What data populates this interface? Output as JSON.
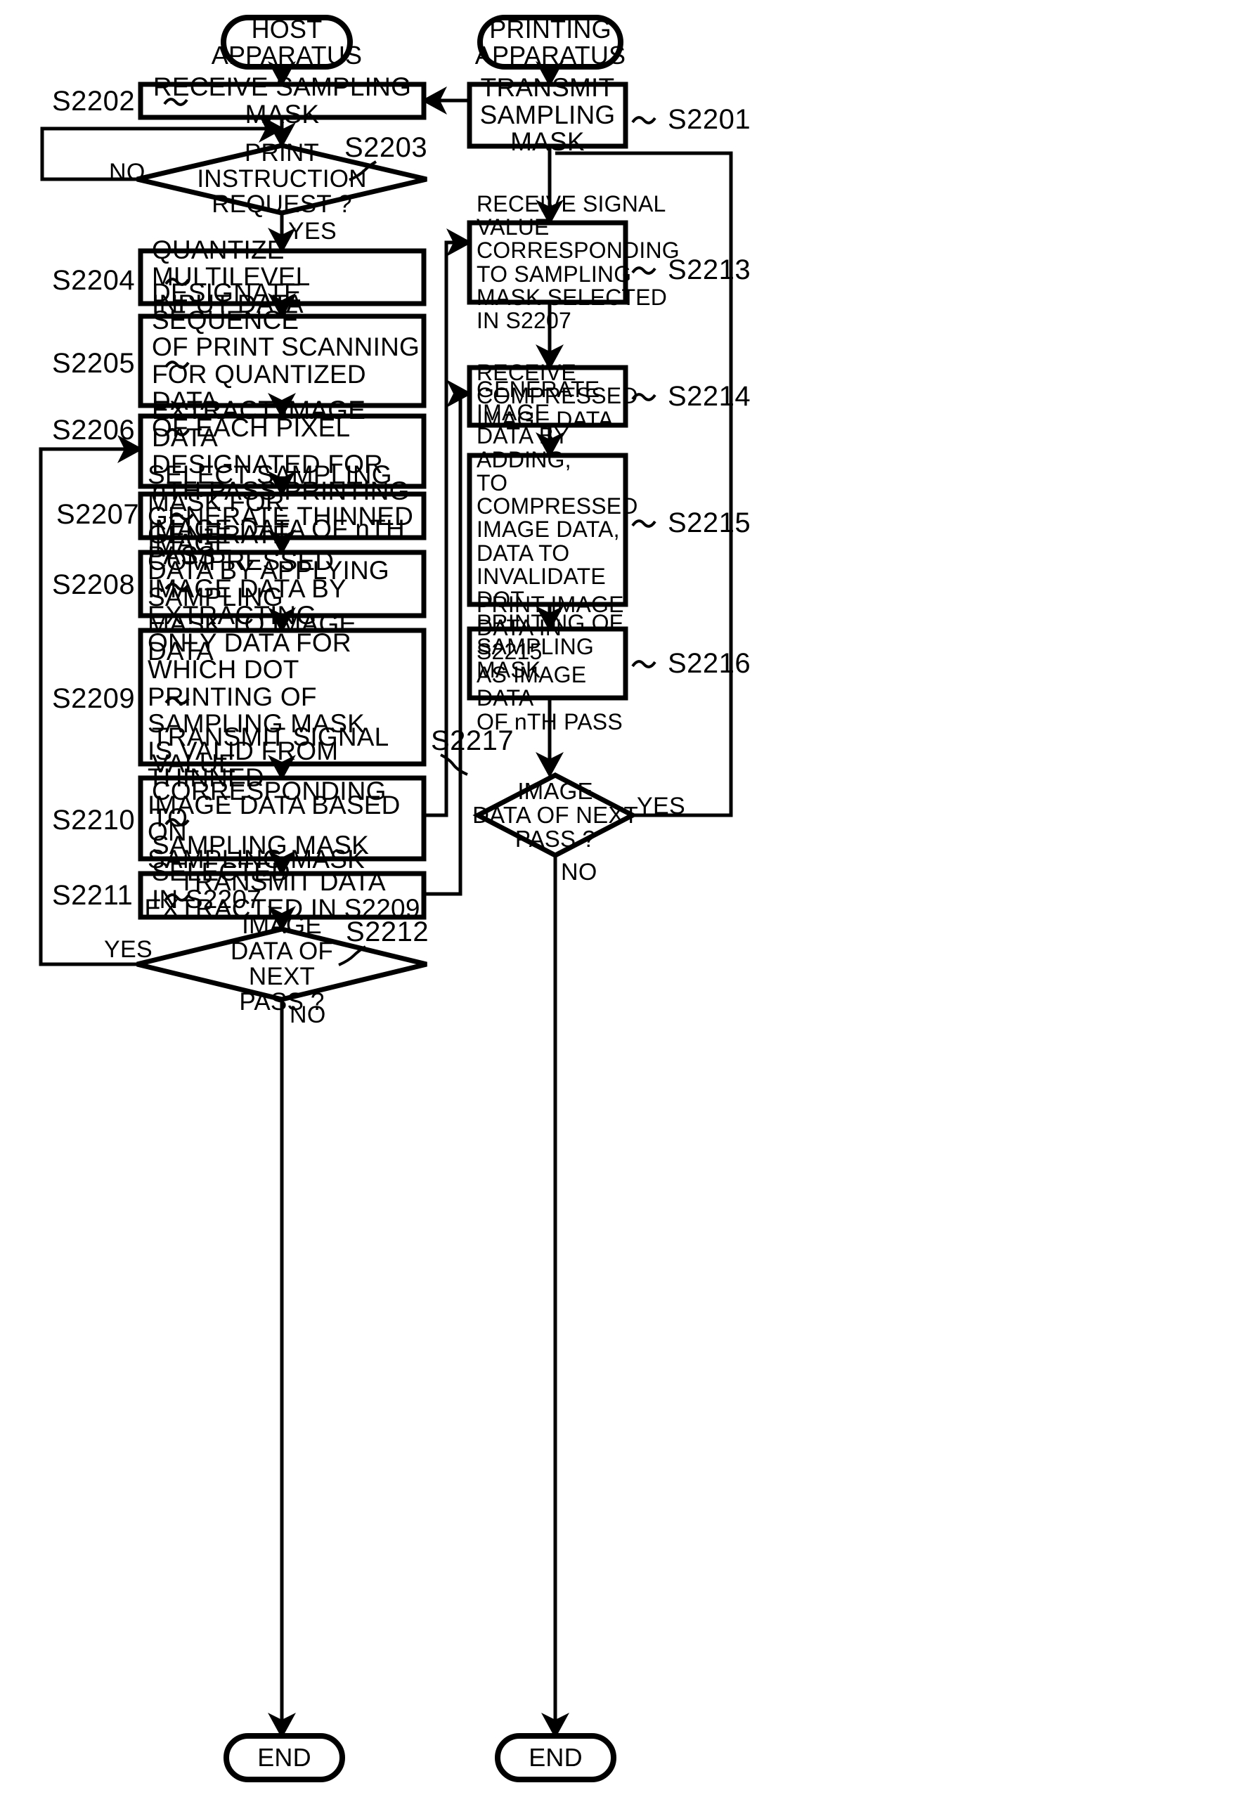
{
  "figure": {
    "type": "flowchart",
    "orientation": "two-column",
    "columns": [
      {
        "id": "host",
        "terminator_start": "HOST\nAPPARATUS"
      },
      {
        "id": "printer",
        "terminator_start": "PRINTING\nAPPARATUS"
      }
    ]
  },
  "terminators": {
    "host_start": "HOST\nAPPARATUS",
    "printer_start": "PRINTING\nAPPARATUS",
    "host_end": "END",
    "printer_end": "END"
  },
  "steps": {
    "s2201": {
      "id": "S2201",
      "text": "TRANSMIT\nSAMPLING\nMASK",
      "shape": "process",
      "align": "center"
    },
    "s2202": {
      "id": "S2202",
      "text": "RECEIVE SAMPLING MASK",
      "shape": "process",
      "align": "center"
    },
    "s2203": {
      "id": "S2203",
      "text": "PRINT\nINSTRUCTION\nREQUEST ?",
      "shape": "decision",
      "align": "center"
    },
    "s2204": {
      "id": "S2204",
      "text": "QUANTIZE MULTILEVEL\nINPUT DATA",
      "shape": "process",
      "align": "left"
    },
    "s2205": {
      "id": "S2205",
      "text": "DESIGNATE SEQUENCE\nOF PRINT SCANNING\nFOR QUANTIZED DATA\nOF EACH PIXEL",
      "shape": "process",
      "align": "left"
    },
    "s2206": {
      "id": "S2206",
      "text": "EXTRACT IMAGE DATA\nDESIGNATED FOR\nnTH PASS PRINTING",
      "shape": "process",
      "align": "left"
    },
    "s2207": {
      "id": "S2207",
      "text": "SELECT SAMPLING MASK FOR\nIMAGE DATA OF nTH PASS",
      "shape": "process",
      "align": "left"
    },
    "s2208": {
      "id": "S2208",
      "text": "GENERATE THINNED IMAGE\nDATA BY APPLYING SAMPLING\nMASK TO IMAGE DATA",
      "shape": "process",
      "align": "left"
    },
    "s2209": {
      "id": "S2209",
      "text": "GENERATE COMPRESSED\nIMAGE DATA BY EXTRACTING\nONLY DATA FOR WHICH DOT\nPRINTING OF SAMPLING MASK\nIS VALID FROM THINNED\nIMAGE DATA BASED ON\nSAMPLING MASK",
      "shape": "process",
      "align": "left"
    },
    "s2210": {
      "id": "S2210",
      "text": "TRANSMIT SIGNAL VALUE\nCORRESPONDING TO\nSAMPLING MASK SELECTED\nIN S2207",
      "shape": "process",
      "align": "left"
    },
    "s2211": {
      "id": "S2211",
      "text": "TRANSMIT DATA\nEXTRACTED IN S2209",
      "shape": "process",
      "align": "center"
    },
    "s2212": {
      "id": "S2212",
      "text": "IMAGE\nDATA OF NEXT\nPASS ?",
      "shape": "decision",
      "align": "center"
    },
    "s2213": {
      "id": "S2213",
      "text": "RECEIVE SIGNAL\nVALUE\nCORRESPONDING\nTO SAMPLING\nMASK SELECTED\nIN S2207",
      "shape": "process",
      "align": "left"
    },
    "s2214": {
      "id": "S2214",
      "text": "RECEIVE\nCOMPRESSED\nIMAGE DATA",
      "shape": "process",
      "align": "left"
    },
    "s2215": {
      "id": "S2215",
      "text": "GENERATE IMAGE\nDATA BY ADDING,\nTO COMPRESSED\nIMAGE DATA,\nDATA TO\nINVALIDATE DOT\nPRINTING OF\nSAMPLING MASK",
      "shape": "process",
      "align": "left"
    },
    "s2216": {
      "id": "S2216",
      "text": "PRINT IMAGE\nDATA IN S2215\nAS IMAGE DATA\nOF nTH PASS",
      "shape": "process",
      "align": "left"
    },
    "s2217": {
      "id": "S2217",
      "text": "IMAGE\nDATA OF NEXT\nPASS ?",
      "shape": "decision",
      "align": "center"
    }
  },
  "edge_labels": {
    "s2203_no": "NO",
    "s2203_yes": "YES",
    "s2212_yes": "YES",
    "s2212_no": "NO",
    "s2217_yes": "YES",
    "s2217_no": "NO"
  },
  "colors": {
    "stroke": "#000000",
    "background": "#ffffff",
    "text": "#000000"
  }
}
